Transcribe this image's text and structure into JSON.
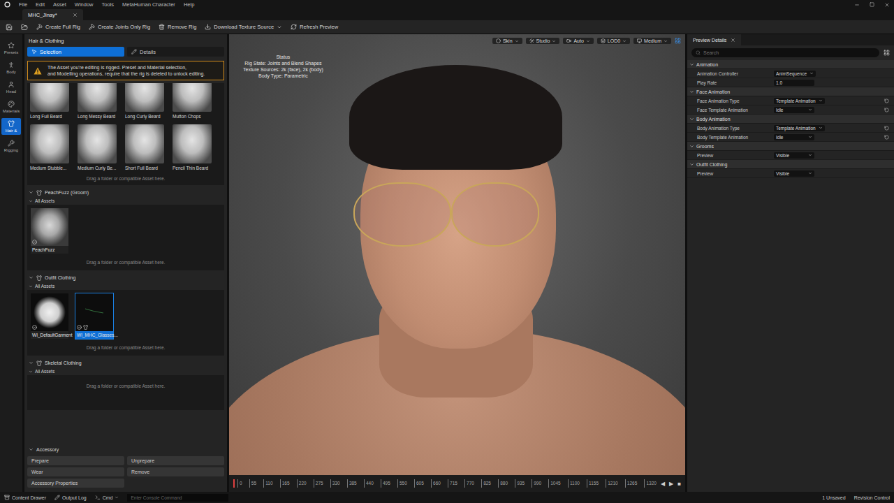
{
  "window": {
    "title": "MHC_Jinay*",
    "menu": [
      "File",
      "Edit",
      "Asset",
      "Window",
      "Tools",
      "MetaHuman Character",
      "Help"
    ]
  },
  "toolbar": {
    "buttons": [
      {
        "label": "Create Full Rig",
        "dropdown": false
      },
      {
        "label": "Create Joints Only Rig",
        "dropdown": false
      },
      {
        "label": "Remove Rig",
        "dropdown": false
      },
      {
        "label": "Download Texture Source",
        "dropdown": true
      },
      {
        "label": "Refresh Preview",
        "dropdown": false
      }
    ]
  },
  "sidebar": {
    "items": [
      {
        "label": "Presets",
        "selected": false
      },
      {
        "label": "Body",
        "selected": false
      },
      {
        "label": "Head",
        "selected": false
      },
      {
        "label": "Materials",
        "selected": false
      },
      {
        "label": "Hair &",
        "selected": true
      },
      {
        "label": "Rigging",
        "selected": false
      }
    ]
  },
  "left_panel": {
    "title": "Hair & Clothing",
    "tabs": [
      {
        "label": "Selection",
        "selected": true
      },
      {
        "label": "Details",
        "selected": false
      }
    ],
    "warning": [
      "The Asset you're editing is rigged. Preset and Material selection,",
      "and Modelling operations, require that the rig is deleted to unlock editing."
    ],
    "beards": {
      "items": [
        {
          "label": "Long Full Beard",
          "selected": false
        },
        {
          "label": "Long Messy Beard",
          "selected": false
        },
        {
          "label": "Long Curly Beard",
          "selected": false
        },
        {
          "label": "Mutton Chops",
          "selected": false
        },
        {
          "label": "Medium Stubble...",
          "selected": false
        },
        {
          "label": "Medium Curly Be...",
          "selected": false
        },
        {
          "label": "Short Full Beard",
          "selected": false
        },
        {
          "label": "Pencil Thin Beard",
          "selected": false
        }
      ],
      "hint": "Drag a folder or compatible Asset here."
    },
    "sections": [
      {
        "title": "PeachFuzz (Groom)",
        "expanded": true,
        "subheader": "All Assets",
        "items": [
          {
            "label": "PeachFuzz",
            "kind": "groom",
            "selected": false,
            "checked": true
          }
        ],
        "hint": "Drag a folder or compatible Asset here."
      },
      {
        "title": "Outfit Clothing",
        "expanded": true,
        "subheader": "All Assets",
        "items": [
          {
            "label": "WI_DefaultGarment",
            "kind": "garment",
            "selected": false,
            "checked": true
          },
          {
            "label": "WI_MHC_Glasses...",
            "kind": "glasses",
            "selected": true,
            "checked": true
          }
        ],
        "hint": "Drag a folder or compatible Asset here."
      },
      {
        "title": "Skeletal Clothing",
        "expanded": true,
        "subheader": "All Assets",
        "items": [],
        "hint": "Drag a folder or compatible Asset here."
      }
    ],
    "accessory": {
      "title": "Accessory",
      "buttons": [
        "Prepare",
        "Unprepare",
        "Wear",
        "Remove",
        "Accessory Properties"
      ]
    }
  },
  "viewport": {
    "toolbar": [
      "Skin",
      "Studio",
      "Auto",
      "LOD0",
      "Medium"
    ],
    "status": {
      "title": "Status",
      "lines": [
        "Rig State: Joints and Blend Shapes",
        "Texture Sources: 2k (face), 2k (body)",
        "Body Type: Parametric"
      ]
    },
    "timeline": {
      "ticks": [
        "0",
        "55",
        "110",
        "165",
        "220",
        "275",
        "330",
        "385",
        "440",
        "495",
        "550",
        "605",
        "660",
        "715",
        "770",
        "825",
        "880",
        "935",
        "990",
        "1045",
        "1100",
        "1155",
        "1210",
        "1265",
        "1320"
      ],
      "controls": [
        "◀",
        "▶",
        "■"
      ]
    }
  },
  "right_panel": {
    "tab": "Preview Details",
    "search_placeholder": "Search",
    "sections": [
      {
        "title": "Animation",
        "expanded": true,
        "rows": [
          {
            "label": "Animation Controller",
            "value": "AnimSequence",
            "kind": "dropdown",
            "resettable": false
          },
          {
            "label": "Play Rate",
            "value": "1.0",
            "kind": "number",
            "resettable": false
          }
        ]
      },
      {
        "title": "Face Animation",
        "expanded": true,
        "rows": [
          {
            "label": "Face Animation Type",
            "value": "Template Animation",
            "kind": "dropdown",
            "resettable": true
          },
          {
            "label": "Face Template Animation",
            "value": "Idle",
            "kind": "dropdown",
            "resettable": true
          }
        ]
      },
      {
        "title": "Body Animation",
        "expanded": true,
        "rows": [
          {
            "label": "Body Animation Type",
            "value": "Template Animation",
            "kind": "dropdown",
            "resettable": true
          },
          {
            "label": "Body Template Animation",
            "value": "Idle",
            "kind": "dropdown",
            "resettable": true
          }
        ]
      },
      {
        "title": "Grooms",
        "expanded": true,
        "rows": [
          {
            "label": "Preview",
            "value": "Visible",
            "kind": "dropdown",
            "resettable": false
          }
        ]
      },
      {
        "title": "Outfit Clothing",
        "expanded": true,
        "rows": [
          {
            "label": "Preview",
            "value": "Visible",
            "kind": "dropdown",
            "resettable": false
          }
        ]
      }
    ]
  },
  "status_bar": {
    "left": [
      "Content Drawer",
      "Output Log",
      "Cmd"
    ],
    "console_placeholder": "Enter Console Command",
    "right": [
      "1 Unsaved",
      "Revision Control"
    ]
  }
}
